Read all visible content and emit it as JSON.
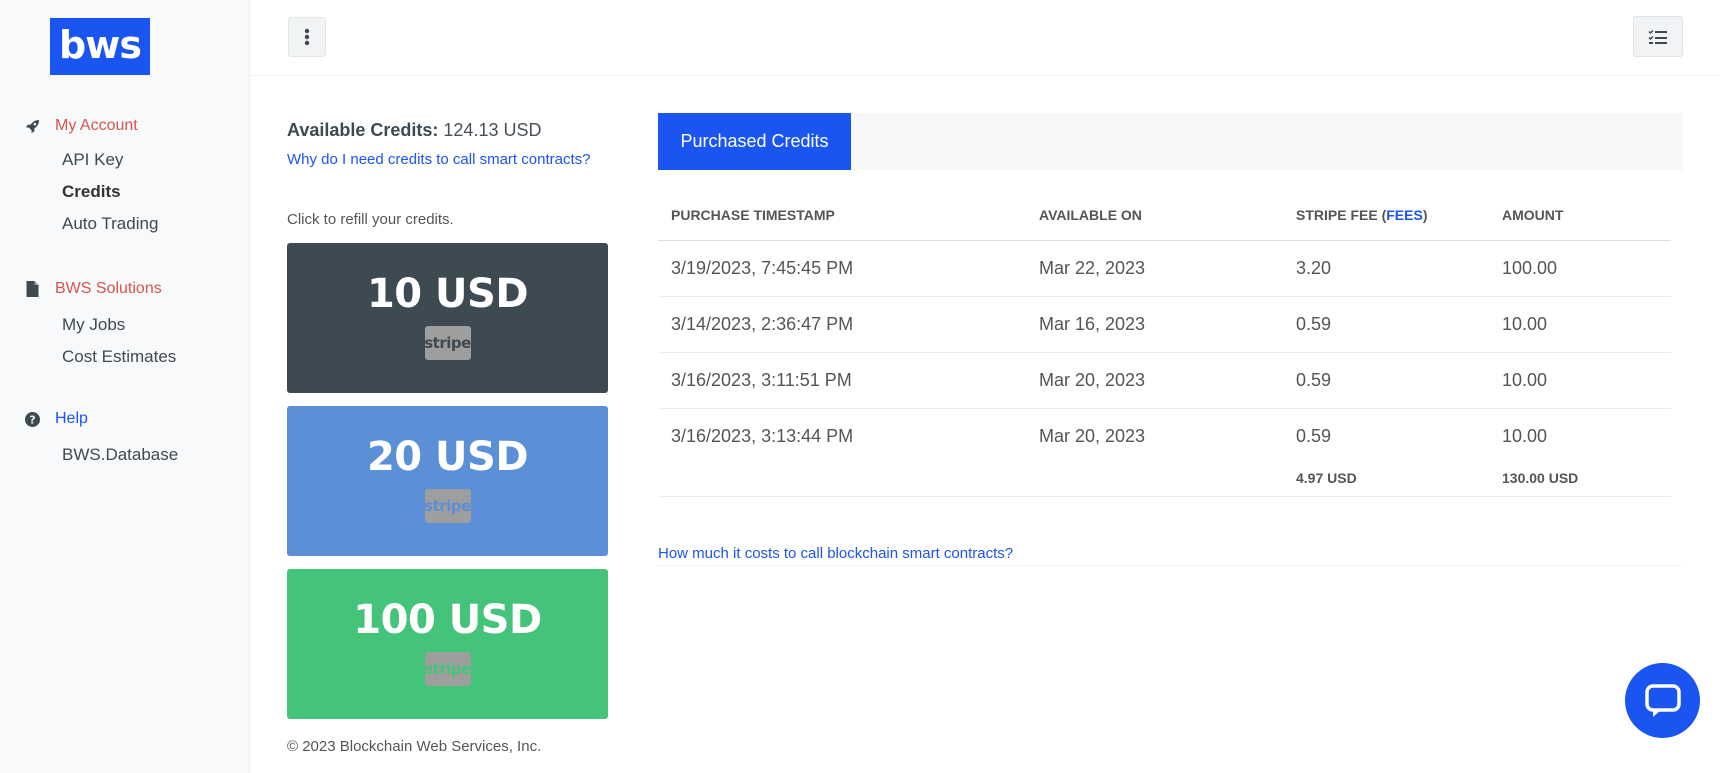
{
  "brand": {
    "logo_text": "bws",
    "color": "#1a55f2"
  },
  "sidebar": {
    "sections": [
      {
        "title": "My Account",
        "icon": "rocket-icon",
        "items": [
          "API Key",
          "Credits",
          "Auto Trading"
        ]
      },
      {
        "title": "BWS Solutions",
        "icon": "file-icon",
        "items": [
          "My Jobs",
          "Cost Estimates"
        ]
      },
      {
        "title": "Help",
        "icon": "question-circle-icon",
        "items": [
          "BWS.Database"
        ]
      }
    ],
    "active_item": "Credits"
  },
  "topbar": {
    "menu_icon": "kebab-menu-icon",
    "list_icon": "checklist-icon"
  },
  "credits": {
    "label": "Available Credits:",
    "value": "124.13 USD",
    "why_link": "Why do I need credits to call smart contracts?",
    "refill_hint": "Click to refill your credits.",
    "packages": [
      {
        "amount": "10 USD",
        "badge": "stripe",
        "color": "#3e4a51"
      },
      {
        "amount": "20 USD",
        "badge": "stripe",
        "color": "#5b8fd6"
      },
      {
        "amount": "100 USD",
        "badge": "stripe",
        "color": "#44c47a"
      }
    ]
  },
  "purchases": {
    "tab": "Purchased Credits",
    "columns": [
      "PURCHASE TIMESTAMP",
      "AVAILABLE ON",
      "STRIPE FEE (",
      "fees",
      ")",
      "AMOUNT"
    ],
    "rows": [
      {
        "timestamp": "3/19/2023, 7:45:45 PM",
        "available_on": "Mar 22, 2023",
        "fee": "3.20",
        "amount": "100.00"
      },
      {
        "timestamp": "3/14/2023, 2:36:47 PM",
        "available_on": "Mar 16, 2023",
        "fee": "0.59",
        "amount": "10.00"
      },
      {
        "timestamp": "3/16/2023, 3:11:51 PM",
        "available_on": "Mar 20, 2023",
        "fee": "0.59",
        "amount": "10.00"
      },
      {
        "timestamp": "3/16/2023, 3:13:44 PM",
        "available_on": "Mar 20, 2023",
        "fee": "0.59",
        "amount": "10.00"
      }
    ],
    "totals": {
      "fee": "4.97 USD",
      "amount": "130.00 USD"
    },
    "cost_link": "How much it costs to call blockchain smart contracts?"
  },
  "footer": {
    "copyright": "© 2023 Blockchain Web Services, Inc."
  },
  "chat": {
    "icon": "chat-bubble-icon"
  }
}
